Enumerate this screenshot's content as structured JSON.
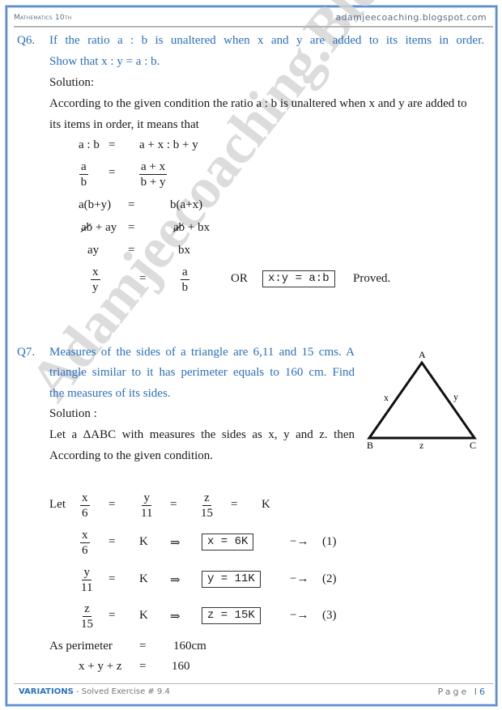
{
  "header": {
    "subject": "Mathematics 10th",
    "website": "adamjeecoaching.blogspot.com"
  },
  "watermark": "Adamjeecoaching.Blogspot.com",
  "q6": {
    "number": "Q6.",
    "question_line1": "If the ratio a : b is unaltered when x and y are added to its items in order.",
    "question_line2": "Show that x : y = a : b.",
    "solution_label": "Solution:",
    "para_line1": "According to the given condition the ratio a : b is unaltered when x and y are added to",
    "para_line2": "its items in order, it means that",
    "steps": {
      "s1_lhs": "a : b",
      "s1_eq": "=",
      "s1_rhs": "a + x : b + y",
      "s2_lhs_num": "a",
      "s2_lhs_den": "b",
      "s2_eq": "=",
      "s2_rhs_num": "a + x",
      "s2_rhs_den": "b + y",
      "s3_lhs": "a(b+y)",
      "s3_eq": "=",
      "s3_rhs": "b(a+x)",
      "s4_lhs_cancel": "ab",
      "s4_lhs_rest": " + ay",
      "s4_eq": "=",
      "s4_rhs_cancel": "ab",
      "s4_rhs_rest": " + bx",
      "s5_lhs": "ay",
      "s5_eq": "=",
      "s5_rhs": "bx",
      "s6_lhs_num": "x",
      "s6_lhs_den": "y",
      "s6_eq": "=",
      "s6_rhs_num": "a",
      "s6_rhs_den": "b",
      "or": "OR",
      "boxed": "x:y = a:b",
      "proved": "Proved."
    }
  },
  "q7": {
    "number": "Q7.",
    "question_line1": "Measures of the sides of a triangle are 6,11 and 15 cms. A",
    "question_line2": "triangle similar to it has perimeter equals to 160 cm.  Find",
    "question_line3": "the measures of its sides.",
    "solution_label": "Solution :",
    "para_line1": "Let a ΔABC with measures the sides as x, y and z. then",
    "para_line2": "According to the given condition.",
    "triangle": {
      "vertex_a": "A",
      "vertex_b": "B",
      "vertex_c": "C",
      "side_ab": "x",
      "side_ac": "y",
      "side_bc": "z"
    },
    "let_label": "Let",
    "ratios": [
      {
        "num": "x",
        "den": "6"
      },
      {
        "num": "y",
        "den": "11"
      },
      {
        "num": "z",
        "den": "15"
      }
    ],
    "eq": "=",
    "k": "K",
    "implies": "⇒",
    "arrow": "−→",
    "results": [
      {
        "num": "x",
        "den": "6",
        "boxed": "x = 6K",
        "tag": "(1)"
      },
      {
        "num": "y",
        "den": "11",
        "boxed": "y = 11K",
        "tag": "(2)"
      },
      {
        "num": "z",
        "den": "15",
        "boxed": "z = 15K",
        "tag": "(3)"
      }
    ],
    "perimeter_label": "As perimeter",
    "perimeter_value": "160cm",
    "sum_lhs": "x + y + z",
    "sum_rhs": "160"
  },
  "footer": {
    "chapter": "VARIATIONS",
    "exercise": " - Solved Exercise # 9.4",
    "page_label": "Page",
    "page_sep": "I",
    "page_number": "6"
  }
}
